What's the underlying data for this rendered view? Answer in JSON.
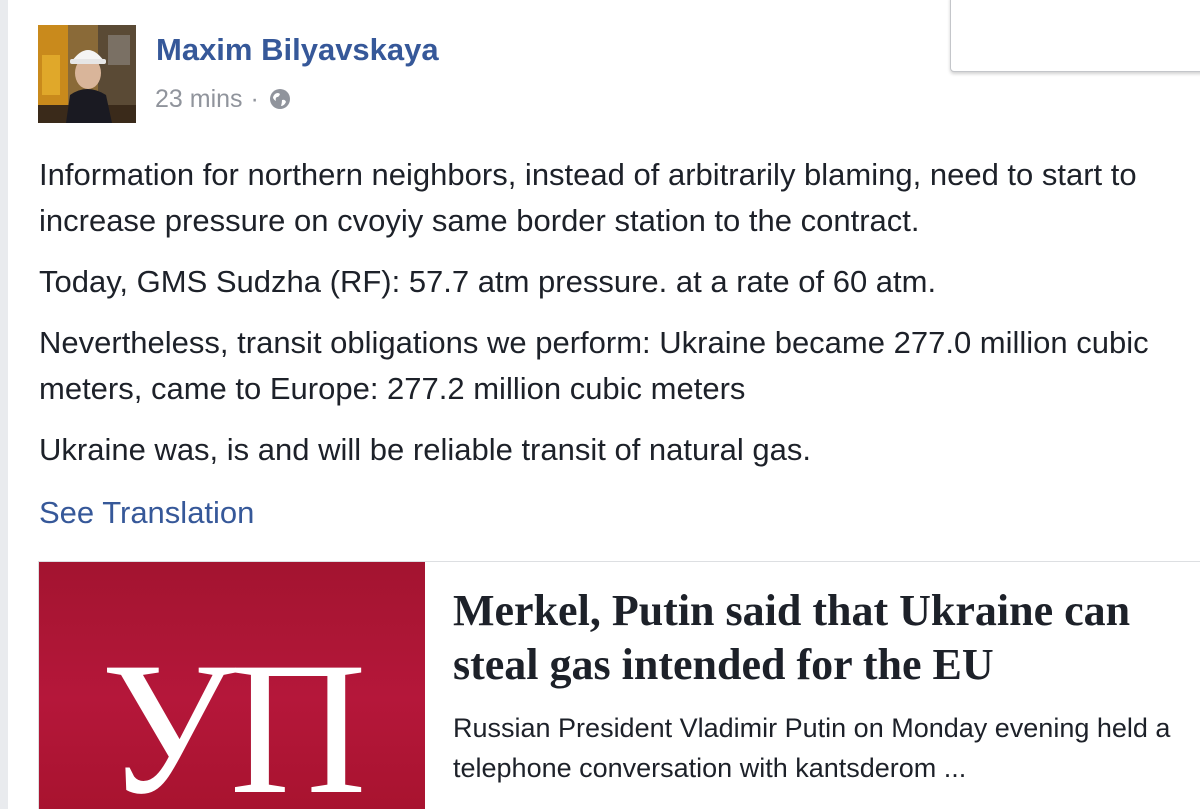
{
  "post": {
    "author": "Maxim Bilyavskaya",
    "timestamp": "23 mins",
    "separator": "·",
    "privacy_icon": "globe-icon",
    "paragraphs": [
      "Information for northern neighbors, instead of arbitrarily blaming, need to start to increase pressure on cvoyiy same border station to the contract.",
      "Today, GMS Sudzha (RF): 57.7 atm pressure. at a rate of 60 atm.",
      "Nevertheless, transit obligations we perform: Ukraine became 277.0 million cubic meters, came to Europe: 277.2 million cubic meters",
      "Ukraine was, is and will be reliable transit of natural gas."
    ],
    "see_translation": "See Translation"
  },
  "link_card": {
    "logo_text": "УП",
    "title": "Merkel, Putin said that Ukraine can steal gas intended for the EU",
    "description": "Russian President Vladimir Putin on Monday evening held a telephone conversation with kantsderom ..."
  },
  "colors": {
    "link_blue": "#365899",
    "meta_gray": "#90949c",
    "text": "#1d2129",
    "card_red": "#a31430"
  }
}
